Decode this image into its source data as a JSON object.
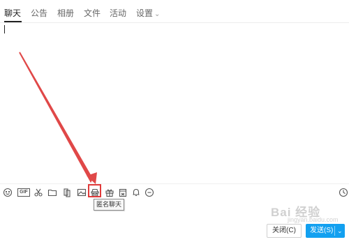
{
  "tabs": [
    {
      "label": "聊天",
      "active": true
    },
    {
      "label": "公告",
      "active": false
    },
    {
      "label": "相册",
      "active": false
    },
    {
      "label": "文件",
      "active": false
    },
    {
      "label": "活动",
      "active": false
    },
    {
      "label": "设置",
      "active": false
    }
  ],
  "toolbar": {
    "icons": [
      "emoji-icon",
      "gif-icon",
      "scissors-icon",
      "folder-icon",
      "shake-icon",
      "image-icon",
      "anonymous-chat-icon",
      "gift-icon",
      "calendar-icon",
      "bell-icon",
      "more-icon",
      "history-clock-icon"
    ],
    "gif_label": "GIF",
    "highlighted": "anonymous-chat-icon"
  },
  "tooltip": {
    "text": "匿名聊天"
  },
  "buttons": {
    "close_label": "关闭(C)",
    "send_label": "发送(S)"
  },
  "watermark": {
    "text": "Bai 经验",
    "sub": "jingyan.baidu.com"
  },
  "colors": {
    "accent": "#12a0f0",
    "highlight": "#e03a3a"
  }
}
